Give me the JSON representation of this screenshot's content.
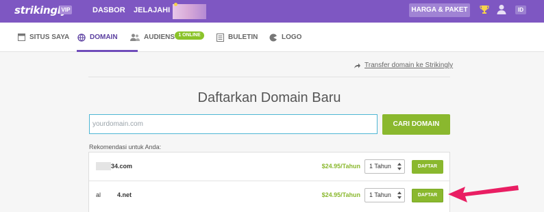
{
  "topbar": {
    "logo": "strikingly",
    "vip": "VIP",
    "nav": [
      "DASBOR",
      "JELAJAHI"
    ],
    "pricing_button": "HARGA & PAKET",
    "id_badge": "ID",
    "icons": [
      "trophy-icon",
      "user-icon"
    ]
  },
  "subnav": {
    "items": [
      {
        "label": "SITUS SAYA",
        "icon": "site-icon"
      },
      {
        "label": "DOMAIN",
        "icon": "domain-icon",
        "active": true
      },
      {
        "label": "AUDIENS",
        "icon": "audience-icon"
      },
      {
        "label": "BULETIN",
        "icon": "newsletter-icon"
      },
      {
        "label": "LOGO",
        "icon": "logo-icon"
      }
    ],
    "online_badge": "1 ONLINE"
  },
  "main": {
    "transfer_link": "Transfer domain ke Strikingly",
    "title": "Daftarkan Domain Baru",
    "search": {
      "placeholder": "yourdomain.com",
      "value": ""
    },
    "search_button": "CARI DOMAIN",
    "recommend_label": "Rekomendasi untuk Anda:",
    "recommendations": [
      {
        "domain_visible": "34.com",
        "price": "$24.95/Tahun",
        "period": "1 Tahun",
        "button": "DAFTAR"
      },
      {
        "domain_visible_prefix": "al",
        "domain_visible": "4.net",
        "price": "$24.95/Tahun",
        "period": "1 Tahun",
        "button": "DAFTAR"
      }
    ]
  },
  "colors": {
    "topbar": "#7e57c2",
    "accent_green": "#8ab82e",
    "active_nav": "#6f4cba",
    "input_border": "#4db6d4",
    "annotation_arrow": "#e91e63"
  }
}
